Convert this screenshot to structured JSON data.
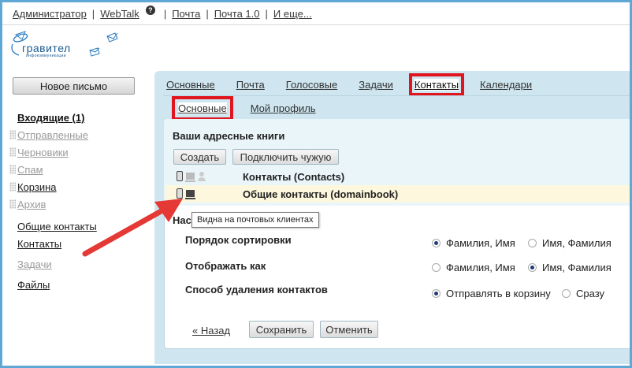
{
  "topnav": {
    "admin": "Администратор",
    "webtalk": "WebTalk",
    "help_icon": "?",
    "mail": "Почта",
    "mail10": "Почта 1.0",
    "more": "И еще..."
  },
  "logo": {
    "name": "гравител",
    "sub": "инфокоммуникации"
  },
  "new_mail_label": "Новое письмо",
  "folders": [
    {
      "label": "Входящие (1)"
    },
    {
      "label": "Отправленные"
    },
    {
      "label": "Черновики"
    },
    {
      "label": "Спам"
    },
    {
      "label": "Корзина"
    },
    {
      "label": "Архив"
    }
  ],
  "side_links": [
    {
      "label": "Общие контакты"
    },
    {
      "label": "Контакты"
    },
    {
      "label": "Задачи"
    },
    {
      "label": "Файлы"
    }
  ],
  "main_tabs": [
    {
      "label": "Основные"
    },
    {
      "label": "Почта"
    },
    {
      "label": "Голосовые"
    },
    {
      "label": "Задачи"
    },
    {
      "label": "Контакты",
      "active": true
    },
    {
      "label": "Календари"
    }
  ],
  "sub_tabs": [
    {
      "label": "Основные",
      "active": true
    },
    {
      "label": "Мой профиль"
    }
  ],
  "books": {
    "title": "Ваши адресные книги",
    "create_label": "Создать",
    "connect_label": "Подключить чужую",
    "items": [
      {
        "name": "Контакты (Contacts)"
      },
      {
        "name": "Общие контакты (domainbook)"
      }
    ],
    "tooltip": "Видна на почтовых клиентах"
  },
  "settings": {
    "title_fragment": "Нас",
    "sort": {
      "label": "Порядок сортировки",
      "opt1": "Фамилия, Имя",
      "opt2": "Имя, Фамилия",
      "selected": "opt1"
    },
    "display": {
      "label": "Отображать как",
      "opt1": "Фамилия, Имя",
      "opt2": "Имя, Фамилия",
      "selected": "opt2"
    },
    "delete": {
      "label": "Способ удаления контактов",
      "opt1": "Отправлять в корзину",
      "opt2": "Сразу",
      "selected": "opt1"
    }
  },
  "footer": {
    "back_label": "« Назад",
    "save_label": "Сохранить",
    "cancel_label": "Отменить"
  },
  "colors": {
    "accent_blue": "#5fa8d6",
    "highlight_red": "#e0151f",
    "panel_bg": "#cfe6f0",
    "arrow": "#e53935"
  }
}
